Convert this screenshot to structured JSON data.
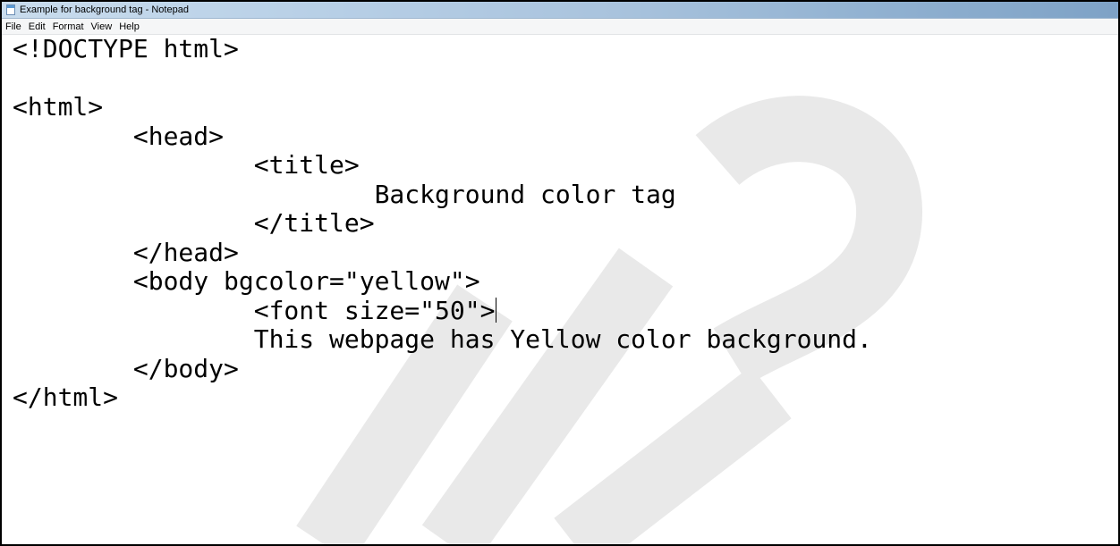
{
  "window": {
    "title": "Example for background tag - Notepad",
    "icon": "notepad-icon"
  },
  "menu": {
    "items": [
      {
        "label": "File"
      },
      {
        "label": "Edit"
      },
      {
        "label": "Format"
      },
      {
        "label": "View"
      },
      {
        "label": "Help"
      }
    ]
  },
  "editor": {
    "lines": [
      "<!DOCTYPE html>",
      "",
      "<html>",
      "        <head>",
      "                <title>",
      "                        Background color tag",
      "                </title>",
      "        </head>",
      "        <body bgcolor=\"yellow\">",
      "                <font size=\"50\">",
      "                This webpage has Yellow color background.",
      "        </body>",
      "</html>"
    ],
    "caret_line": 9
  },
  "colors": {
    "titlebar_accent": "#a9c3dd",
    "watermark": "#e9e9e9"
  }
}
